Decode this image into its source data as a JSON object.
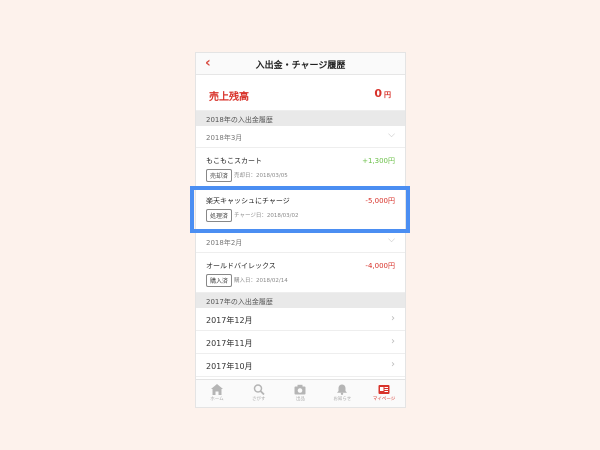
{
  "header": {
    "back_icon": "chevron-left-icon",
    "title": "入出金・チャージ履歴"
  },
  "balance": {
    "label": "売上残高",
    "amount": "0",
    "unit": "円"
  },
  "sections": {
    "y2018": "2018年の入出金履歴",
    "y2017": "2017年の入出金履歴"
  },
  "months": {
    "m2018_03": "2018年3月",
    "m2018_02": "2018年2月"
  },
  "transactions": [
    {
      "name": "もこもこスカート",
      "amount": "+1,300円",
      "badge": "売却済",
      "date": "売却日：2018/03/05"
    },
    {
      "name": "楽天キャッシュにチャージ",
      "amount": "-5,000円",
      "badge": "処理済",
      "date": "チャージ日：2018/03/02"
    },
    {
      "name": "オールドバイレックス",
      "amount": "-4,000円",
      "badge": "購入済",
      "date": "購入日：2018/02/14"
    }
  ],
  "year_items": [
    "2017年12月",
    "2017年11月",
    "2017年10月"
  ],
  "tabbar": [
    {
      "label": "ホーム",
      "icon": "home-icon"
    },
    {
      "label": "さがす",
      "icon": "search-icon"
    },
    {
      "label": "出品",
      "icon": "camera-icon"
    },
    {
      "label": "お知らせ",
      "icon": "bell-icon"
    },
    {
      "label": "マイページ",
      "icon": "mypage-icon"
    }
  ],
  "colors": {
    "accent_red": "#d8322a",
    "positive_green": "#6cc04a",
    "highlight_blue": "#4b8ef2",
    "background": "#fdf2ec"
  }
}
